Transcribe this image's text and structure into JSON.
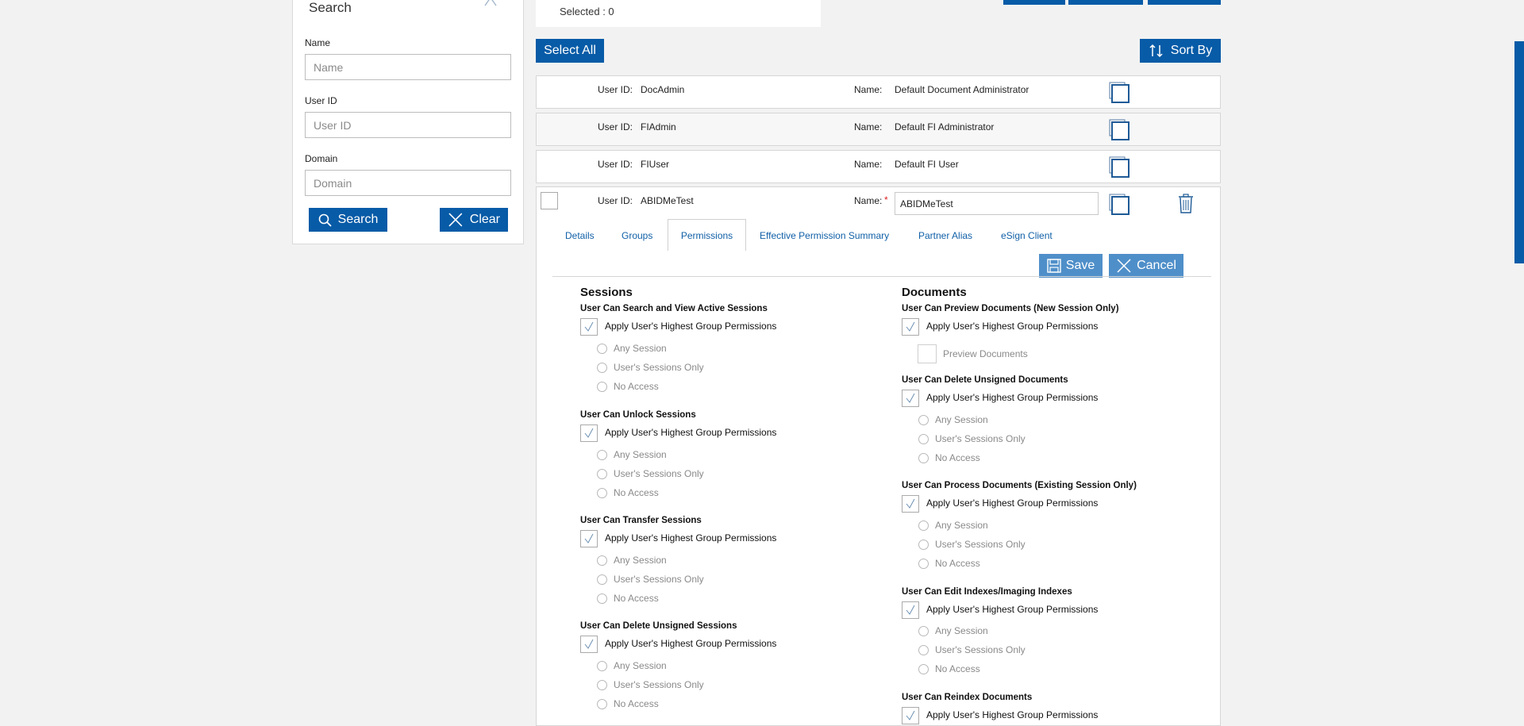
{
  "search": {
    "title": "Search",
    "name_label": "Name",
    "name_placeholder": "Name",
    "userid_label": "User ID",
    "userid_placeholder": "User ID",
    "domain_label": "Domain",
    "domain_placeholder": "Domain",
    "search_button": "Search",
    "clear_button": "Clear"
  },
  "header": {
    "selected_text": "Selected : 0",
    "select_all": "Select All",
    "sort_by": "Sort By"
  },
  "users": [
    {
      "userid_label": "User ID:",
      "userid": "DocAdmin",
      "name_label": "Name:",
      "name": "Default Document Administrator"
    },
    {
      "userid_label": "User ID:",
      "userid": "FIAdmin",
      "name_label": "Name:",
      "name": "Default FI Administrator"
    },
    {
      "userid_label": "User ID:",
      "userid": "FIUser",
      "name_label": "Name:",
      "name": "Default FI User"
    }
  ],
  "editing": {
    "userid_label": "User ID:",
    "userid": "ABIDMeTest",
    "name_label": "Name:",
    "required_mark": "*",
    "name_value": "ABIDMeTest",
    "tabs": [
      "Details",
      "Groups",
      "Permissions",
      "Effective Permission Summary",
      "Partner Alias",
      "eSign Client"
    ],
    "active_tab": "Permissions",
    "save": "Save",
    "cancel": "Cancel"
  },
  "sessions": {
    "heading": "Sessions",
    "apply_label": "Apply User's Highest Group Permissions",
    "options": [
      "Any Session",
      "User's Sessions Only",
      "No Access"
    ],
    "groups": [
      "User Can Search and View Active Sessions",
      "User Can Unlock Sessions",
      "User Can Transfer Sessions",
      "User Can Delete Unsigned Sessions"
    ]
  },
  "documents": {
    "heading": "Documents",
    "apply_label": "Apply User's Highest Group Permissions",
    "options": [
      "Any Session",
      "User's Sessions Only",
      "No Access"
    ],
    "preview_title": "User Can Preview Documents (New Session Only)",
    "preview_option": "Preview Documents",
    "groups": [
      "User Can Delete Unsigned Documents",
      "User Can Process Documents (Existing Session Only)",
      "User Can Edit Indexes/Imaging Indexes"
    ],
    "last_title": "User Can Reindex Documents"
  },
  "colors": {
    "primary": "#075ba7",
    "light_button": "#4f8fc9",
    "link": "#1160a8"
  }
}
